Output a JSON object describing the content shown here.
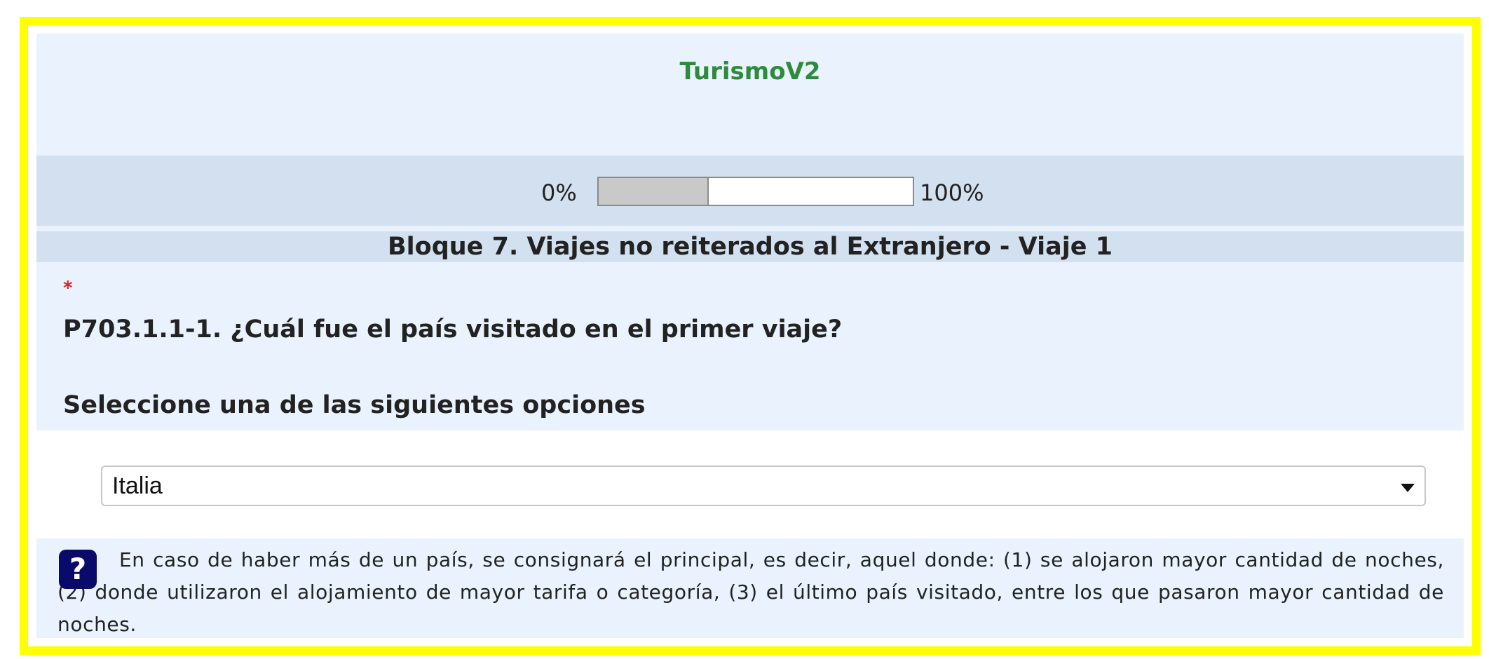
{
  "app": {
    "title": "TurismoV2"
  },
  "progress": {
    "min_label": "0%",
    "max_label": "100%",
    "value": 0.35
  },
  "block": {
    "title": "Bloque 7. Viajes no reiterados al Extranjero - Viaje 1"
  },
  "question": {
    "required_mark": "*",
    "text": "P703.1.1-1. ¿Cuál fue el país visitado en el primer viaje?",
    "instruction": "Seleccione una de las siguientes opciones"
  },
  "select": {
    "value": "Italia"
  },
  "help": {
    "icon": "question-mark-icon",
    "icon_glyph": "?",
    "text": "En caso de haber más de un país, se consignará el principal, es decir, aquel donde: (1) se alojaron mayor cantidad de noches, (2) donde utilizaron el alojamiento de mayor tarifa o categoría, (3) el último país visitado, entre los que pasaron mayor cantidad de noches."
  },
  "colors": {
    "frame": "#ffff00",
    "panel": "#eaf3fd",
    "band": "#d3e0f0",
    "title": "#2e8b3e",
    "help_icon": "#0a0a6a",
    "asterisk": "#e02020"
  }
}
